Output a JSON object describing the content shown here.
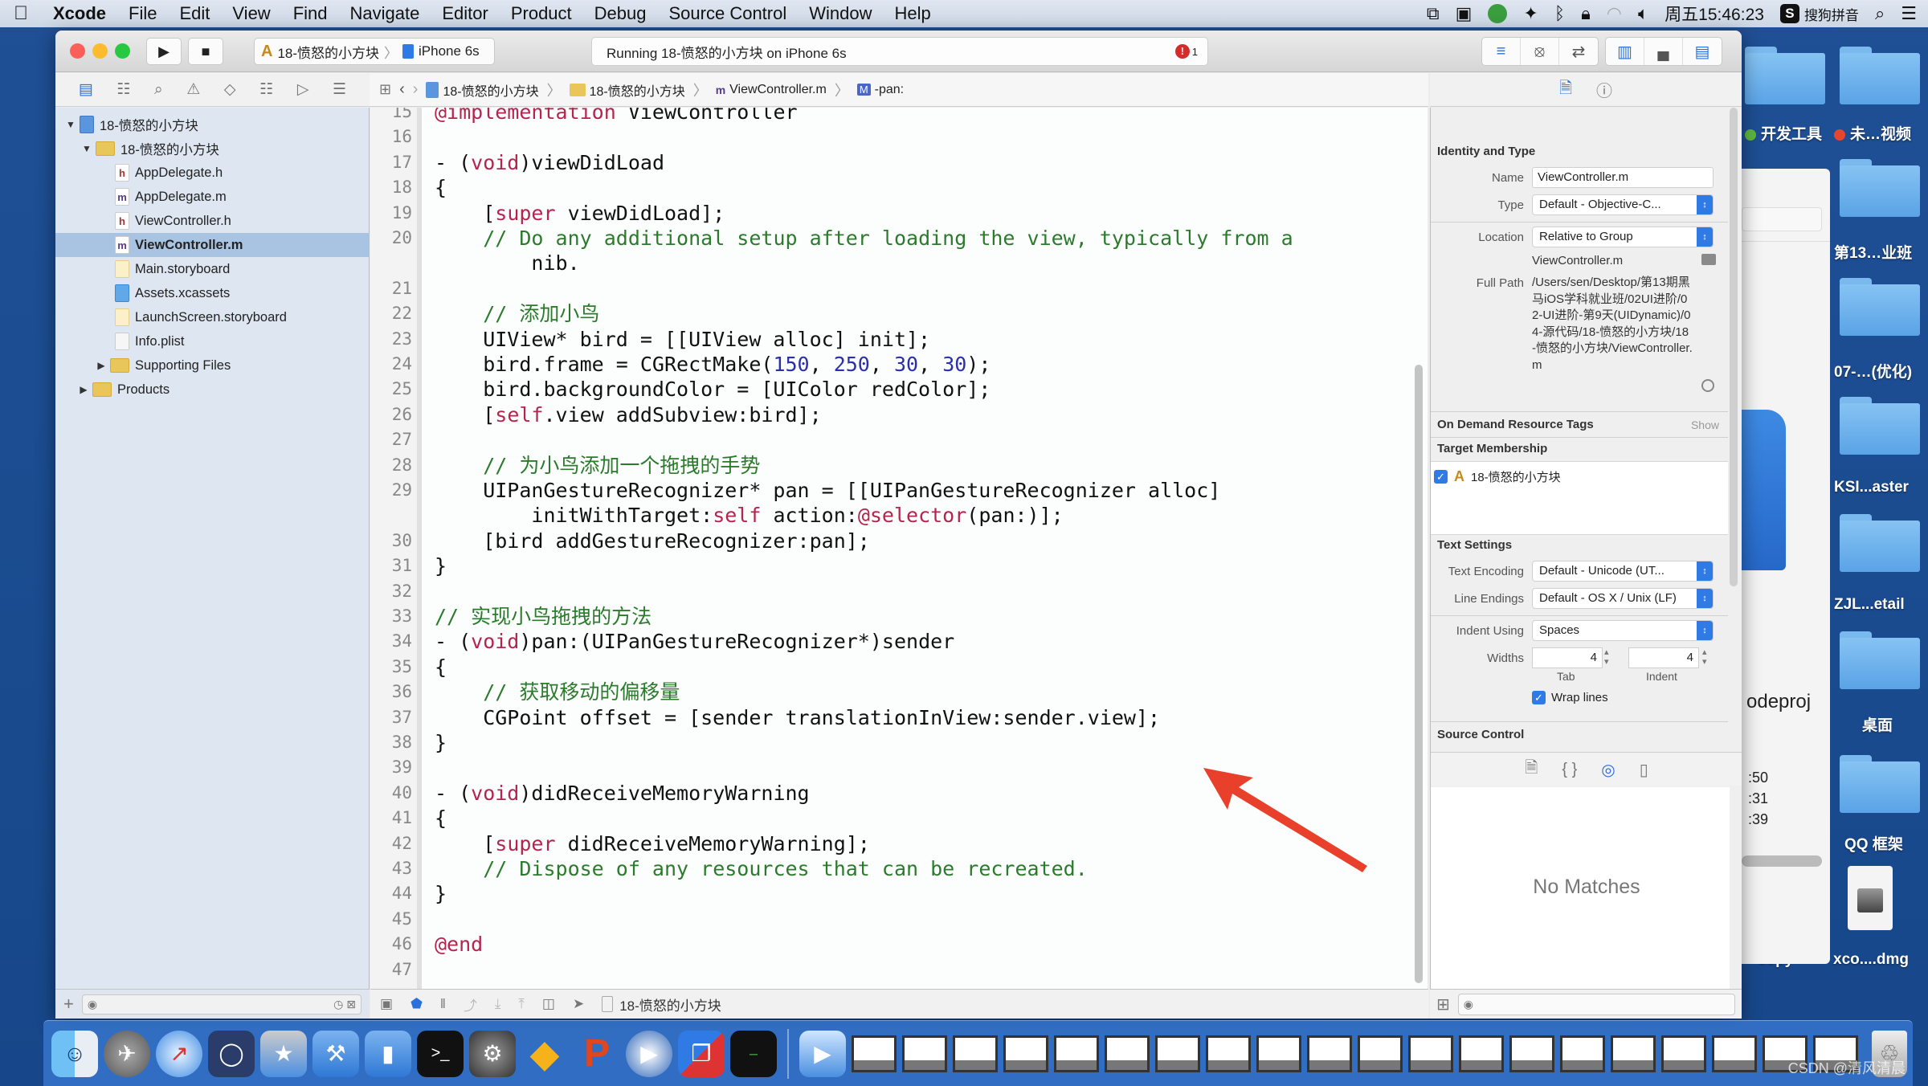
{
  "menubar": {
    "app": "Xcode",
    "items": [
      "File",
      "Edit",
      "View",
      "Find",
      "Navigate",
      "Editor",
      "Product",
      "Debug",
      "Source Control",
      "Window",
      "Help"
    ],
    "clock": "周五15:46:23",
    "ime": "搜狗拼音"
  },
  "toolbar": {
    "scheme": "18-愤怒的小方块",
    "device": "iPhone 6s",
    "status": "Running 18-愤怒的小方块 on iPhone 6s",
    "error_count": "1"
  },
  "jumpbar": {
    "crumbs": [
      "18-愤怒的小方块",
      "18-愤怒的小方块",
      "ViewController.m",
      "-pan:"
    ],
    "method_badge": "M"
  },
  "navigator": {
    "items": [
      {
        "label": "18-愤怒的小方块",
        "kind": "project",
        "expanded": true
      },
      {
        "label": "18-愤怒的小方块",
        "kind": "folder",
        "expanded": true
      },
      {
        "label": "AppDelegate.h",
        "kind": "h"
      },
      {
        "label": "AppDelegate.m",
        "kind": "m"
      },
      {
        "label": "ViewController.h",
        "kind": "h"
      },
      {
        "label": "ViewController.m",
        "kind": "m",
        "selected": true
      },
      {
        "label": "Main.storyboard",
        "kind": "storyboard"
      },
      {
        "label": "Assets.xcassets",
        "kind": "xcassets"
      },
      {
        "label": "LaunchScreen.storyboard",
        "kind": "storyboard"
      },
      {
        "label": "Info.plist",
        "kind": "plist"
      },
      {
        "label": "Supporting Files",
        "kind": "folder",
        "expanded": false
      },
      {
        "label": "Products",
        "kind": "folder",
        "expanded": false
      }
    ]
  },
  "editor": {
    "lines": [
      {
        "n": "15",
        "code": "@implementation ViewController"
      },
      {
        "n": "16",
        "code": ""
      },
      {
        "n": "17",
        "code": "- (void)viewDidLoad"
      },
      {
        "n": "18",
        "code": "{"
      },
      {
        "n": "19",
        "code": "    [super viewDidLoad];"
      },
      {
        "n": "20",
        "code": "    // Do any additional setup after loading the view, typically from a"
      },
      {
        "n": "",
        "code": "        nib."
      },
      {
        "n": "21",
        "code": ""
      },
      {
        "n": "22",
        "code": "    // 添加小鸟"
      },
      {
        "n": "23",
        "code": "    UIView* bird = [[UIView alloc] init];"
      },
      {
        "n": "24",
        "code": "    bird.frame = CGRectMake(150, 250, 30, 30);"
      },
      {
        "n": "25",
        "code": "    bird.backgroundColor = [UIColor redColor];"
      },
      {
        "n": "26",
        "code": "    [self.view addSubview:bird];"
      },
      {
        "n": "27",
        "code": ""
      },
      {
        "n": "28",
        "code": "    // 为小鸟添加一个拖拽的手势"
      },
      {
        "n": "29",
        "code": "    UIPanGestureRecognizer* pan = [[UIPanGestureRecognizer alloc]"
      },
      {
        "n": "",
        "code": "        initWithTarget:self action:@selector(pan:)];"
      },
      {
        "n": "30",
        "code": "    [bird addGestureRecognizer:pan];"
      },
      {
        "n": "31",
        "code": "}"
      },
      {
        "n": "32",
        "code": ""
      },
      {
        "n": "33",
        "code": "// 实现小鸟拖拽的方法"
      },
      {
        "n": "34",
        "code": "- (void)pan:(UIPanGestureRecognizer*)sender"
      },
      {
        "n": "35",
        "code": "{"
      },
      {
        "n": "36",
        "code": "    // 获取移动的偏移量"
      },
      {
        "n": "37",
        "code": "    CGPoint offset = [sender translationInView:sender.view];"
      },
      {
        "n": "38",
        "code": "}"
      },
      {
        "n": "39",
        "code": ""
      },
      {
        "n": "40",
        "code": "- (void)didReceiveMemoryWarning"
      },
      {
        "n": "41",
        "code": "{"
      },
      {
        "n": "42",
        "code": "    [super didReceiveMemoryWarning];"
      },
      {
        "n": "43",
        "code": "    // Dispose of any resources that can be recreated."
      },
      {
        "n": "44",
        "code": "}"
      },
      {
        "n": "45",
        "code": ""
      },
      {
        "n": "46",
        "code": "@end"
      },
      {
        "n": "47",
        "code": ""
      }
    ]
  },
  "inspector": {
    "identity_title": "Identity and Type",
    "name_label": "Name",
    "name_value": "ViewController.m",
    "type_label": "Type",
    "type_value": "Default - Objective-C...",
    "location_label": "Location",
    "location_value": "Relative to Group",
    "location_file": "ViewController.m",
    "fullpath_label": "Full Path",
    "fullpath_value": "/Users/sen/Desktop/第13期黑马iOS学科就业班/02UI进阶/02-UI进阶-第9天(UIDynamic)/04-源代码/18-愤怒的小方块/18-愤怒的小方块/ViewController.m",
    "odr_title": "On Demand Resource Tags",
    "odr_show": "Show",
    "target_title": "Target Membership",
    "target_name": "18-愤怒的小方块",
    "text_settings_title": "Text Settings",
    "encoding_label": "Text Encoding",
    "encoding_value": "Default - Unicode (UT...",
    "line_endings_label": "Line Endings",
    "line_endings_value": "Default - OS X / Unix (LF)",
    "indent_using_label": "Indent Using",
    "indent_using_value": "Spaces",
    "widths_label": "Widths",
    "tab_width": "4",
    "indent_width": "4",
    "tab_caption": "Tab",
    "indent_caption": "Indent",
    "wrap_lines": "Wrap lines",
    "source_control_title": "Source Control",
    "library_empty": "No Matches"
  },
  "debugbar": {
    "target": "18-愤怒的小方块"
  },
  "desktop": {
    "items": [
      "开发工具",
      "未…视频",
      "第13…业班",
      "07-…(优化)",
      "KSI...aster",
      "ZJL...etail",
      "桌面",
      "QQ 框架",
      "xco....dmg",
      "copy",
      "odeproj"
    ],
    "tag_colors": {
      "green": "#5fb93c",
      "red": "#e8452f"
    },
    "partial_times": [
      ":50",
      ":31",
      ":39"
    ]
  },
  "annotation": {
    "arrow_color": "#e8402a"
  },
  "watermark": "CSDN @清风清晨"
}
